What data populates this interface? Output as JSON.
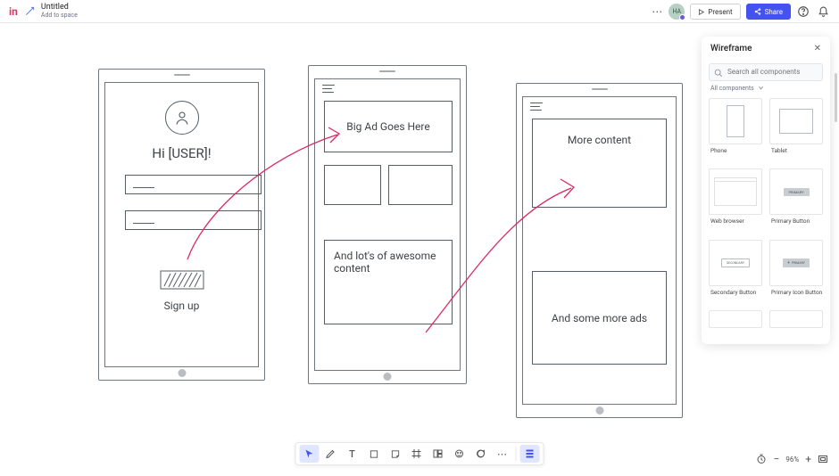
{
  "header": {
    "logo_text": "in",
    "doc_title": "Untitled",
    "doc_subtitle": "Add to space",
    "avatar_initials": "HA",
    "present_label": "Present",
    "share_label": "Share"
  },
  "canvas": {
    "phone1": {
      "greeting": "Hi  [USER]!",
      "signup": "Sign up"
    },
    "phone2": {
      "ad": "Big Ad Goes Here",
      "content": "And lot's of awesome content"
    },
    "phone3": {
      "more": "More content",
      "ads": "And some more ads"
    }
  },
  "panel": {
    "title": "Wireframe",
    "search_placeholder": "Search all components",
    "filter_label": "All components",
    "components": {
      "phone": "Phone",
      "tablet": "Tablet",
      "web": "Web browser",
      "primary_btn": "Primary Button",
      "secondary_btn": "Secondary Button",
      "primary_icon_btn": "Primary Icon Button",
      "primary_badge": "PRIMARY",
      "secondary_badge": "SECONDARY",
      "primary_icon_badge": "PRIMARY"
    }
  },
  "zoom": {
    "value": "96%"
  }
}
